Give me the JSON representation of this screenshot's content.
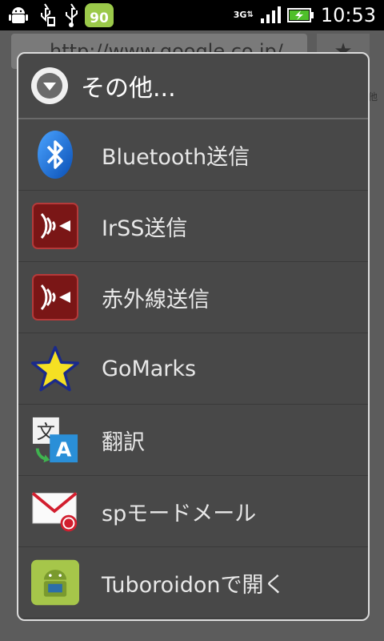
{
  "status_bar": {
    "battery_level_badge": "90",
    "network_type": "3G",
    "time": "10:53",
    "icons": [
      "android-icon",
      "usb-debug-icon",
      "usb-icon",
      "battery-level-icon",
      "network-3g-icon",
      "signal-icon",
      "battery-charging-icon"
    ]
  },
  "background": {
    "url": "http://www.google.co.jp/",
    "side_text": "他"
  },
  "dialog": {
    "title": "その他...",
    "items": [
      {
        "label": "Bluetooth送信",
        "icon": "bluetooth-icon"
      },
      {
        "label": "IrSS送信",
        "icon": "infrared-icon"
      },
      {
        "label": "赤外線送信",
        "icon": "infrared-icon"
      },
      {
        "label": "GoMarks",
        "icon": "star-icon"
      },
      {
        "label": "翻訳",
        "icon": "translate-icon"
      },
      {
        "label": "spモードメール",
        "icon": "mail-icon"
      },
      {
        "label": "Tuboroidonで開く",
        "icon": "tuboroid-icon"
      }
    ]
  },
  "colors": {
    "dialog_bg": "#484848",
    "dialog_border": "#dcdcdc",
    "bluetooth": "#1f6fd6",
    "infrared": "#8a1a1a",
    "star": "#f5e023",
    "tuboroid": "#a6c64a"
  }
}
